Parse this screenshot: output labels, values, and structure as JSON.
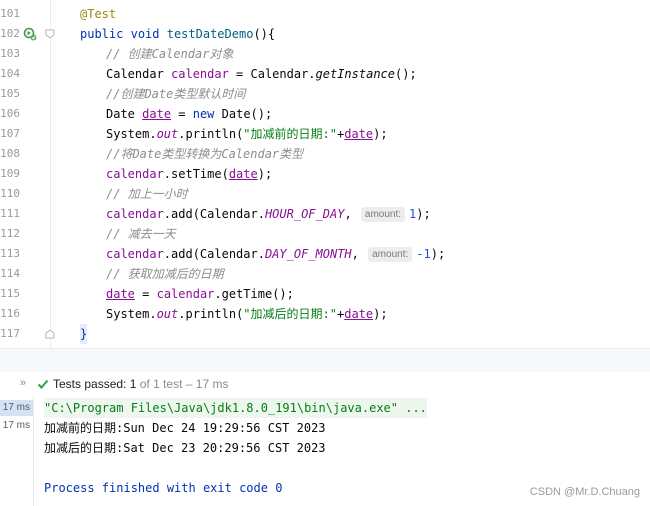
{
  "editor": {
    "line_numbers": [
      "101",
      "102",
      "103",
      "104",
      "105",
      "106",
      "107",
      "108",
      "109",
      "110",
      "111",
      "112",
      "113",
      "114",
      "115",
      "116",
      "117"
    ],
    "lines": {
      "l101": {
        "annotation": "@Test"
      },
      "l102": {
        "kw1": "public",
        "kw2": "void",
        "method": "testDateDemo",
        "rest": "(){"
      },
      "l103": {
        "comment": "// 创建Calendar对象"
      },
      "l104": {
        "type": "Calendar",
        "var": "calendar",
        "eq": " = Calendar.",
        "call": "getInstance",
        "end": "();"
      },
      "l105": {
        "comment": "//创建Date类型默认时间"
      },
      "l106": {
        "type": "Date",
        "var": "date",
        "eq": " = ",
        "kw": "new",
        "rest": " Date();"
      },
      "l107": {
        "pre": "System.",
        "field": "out",
        "mid": ".println(",
        "str": "\"加减前的日期:\"",
        "plus": "+",
        "var": "date",
        "end": ");"
      },
      "l108": {
        "comment": "//将Date类型转换为Calendar类型"
      },
      "l109": {
        "var": "calendar",
        "mid": ".setTime(",
        "arg": "date",
        "end": ");"
      },
      "l110": {
        "comment": "// 加上一小时"
      },
      "l111": {
        "var": "calendar",
        "mid": ".add(Calendar.",
        "field": "HOUR_OF_DAY",
        "comma": ",",
        "hint": "amount:",
        "num": "1",
        "end": ");"
      },
      "l112": {
        "comment": "// 减去一天"
      },
      "l113": {
        "var": "calendar",
        "mid": ".add(Calendar.",
        "field": "DAY_OF_MONTH",
        "comma": ",",
        "hint": "amount:",
        "num": "-1",
        "end": ");"
      },
      "l114": {
        "comment": "// 获取加减后的日期"
      },
      "l115": {
        "var": "date",
        "eq": " = ",
        "var2": "calendar",
        "rest": ".getTime();"
      },
      "l116": {
        "pre": "System.",
        "field": "out",
        "mid": ".println(",
        "str": "\"加减后的日期:\"",
        "plus": "+",
        "var": "date",
        "end": ");"
      },
      "l117": {
        "brace": "}"
      }
    }
  },
  "test_status": {
    "label": "Tests passed:",
    "count": "1",
    "detail": "of 1 test – 17 ms"
  },
  "console": {
    "times": [
      "17 ms",
      "17 ms"
    ],
    "command": "\"C:\\Program Files\\Java\\jdk1.8.0_191\\bin\\java.exe\" ...",
    "output1": "加减前的日期:Sun Dec 24 19:29:56 CST 2023",
    "output2": "加减后的日期:Sat Dec 23 20:29:56 CST 2023",
    "exit": "Process finished with exit code 0"
  },
  "watermark": "CSDN @Mr.D.Chuang",
  "icons": {
    "run": "run-test-icon",
    "check": "check-icon",
    "expand": "double-chevron-icon"
  }
}
